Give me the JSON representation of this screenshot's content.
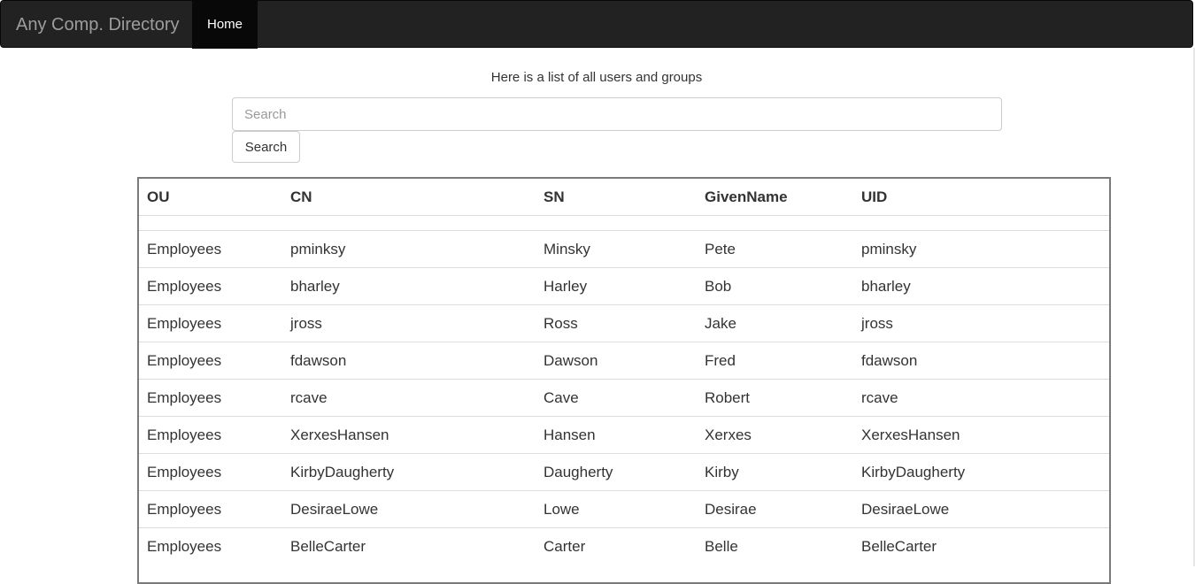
{
  "navbar": {
    "brand": "Any Comp. Directory",
    "home_label": "Home"
  },
  "main": {
    "subtitle": "Here is a list of all users and groups",
    "search": {
      "placeholder": "Search",
      "value": "",
      "button_label": "Search"
    }
  },
  "table": {
    "headers": {
      "ou": "OU",
      "cn": "CN",
      "sn": "SN",
      "givenname": "GivenName",
      "uid": "UID"
    },
    "rows": [
      {
        "ou": "Employees",
        "cn": "pminksy",
        "sn": "Minsky",
        "givenname": "Pete",
        "uid": "pminsky"
      },
      {
        "ou": "Employees",
        "cn": "bharley",
        "sn": "Harley",
        "givenname": "Bob",
        "uid": "bharley"
      },
      {
        "ou": "Employees",
        "cn": "jross",
        "sn": "Ross",
        "givenname": "Jake",
        "uid": "jross"
      },
      {
        "ou": "Employees",
        "cn": "fdawson",
        "sn": "Dawson",
        "givenname": "Fred",
        "uid": "fdawson"
      },
      {
        "ou": "Employees",
        "cn": "rcave",
        "sn": "Cave",
        "givenname": "Robert",
        "uid": "rcave"
      },
      {
        "ou": "Employees",
        "cn": "XerxesHansen",
        "sn": "Hansen",
        "givenname": "Xerxes",
        "uid": "XerxesHansen"
      },
      {
        "ou": "Employees",
        "cn": "KirbyDaugherty",
        "sn": "Daugherty",
        "givenname": "Kirby",
        "uid": "KirbyDaugherty"
      },
      {
        "ou": "Employees",
        "cn": "DesiraeLowe",
        "sn": "Lowe",
        "givenname": "Desirae",
        "uid": "DesiraeLowe"
      },
      {
        "ou": "Employees",
        "cn": "BelleCarter",
        "sn": "Carter",
        "givenname": "Belle",
        "uid": "BelleCarter"
      }
    ]
  }
}
